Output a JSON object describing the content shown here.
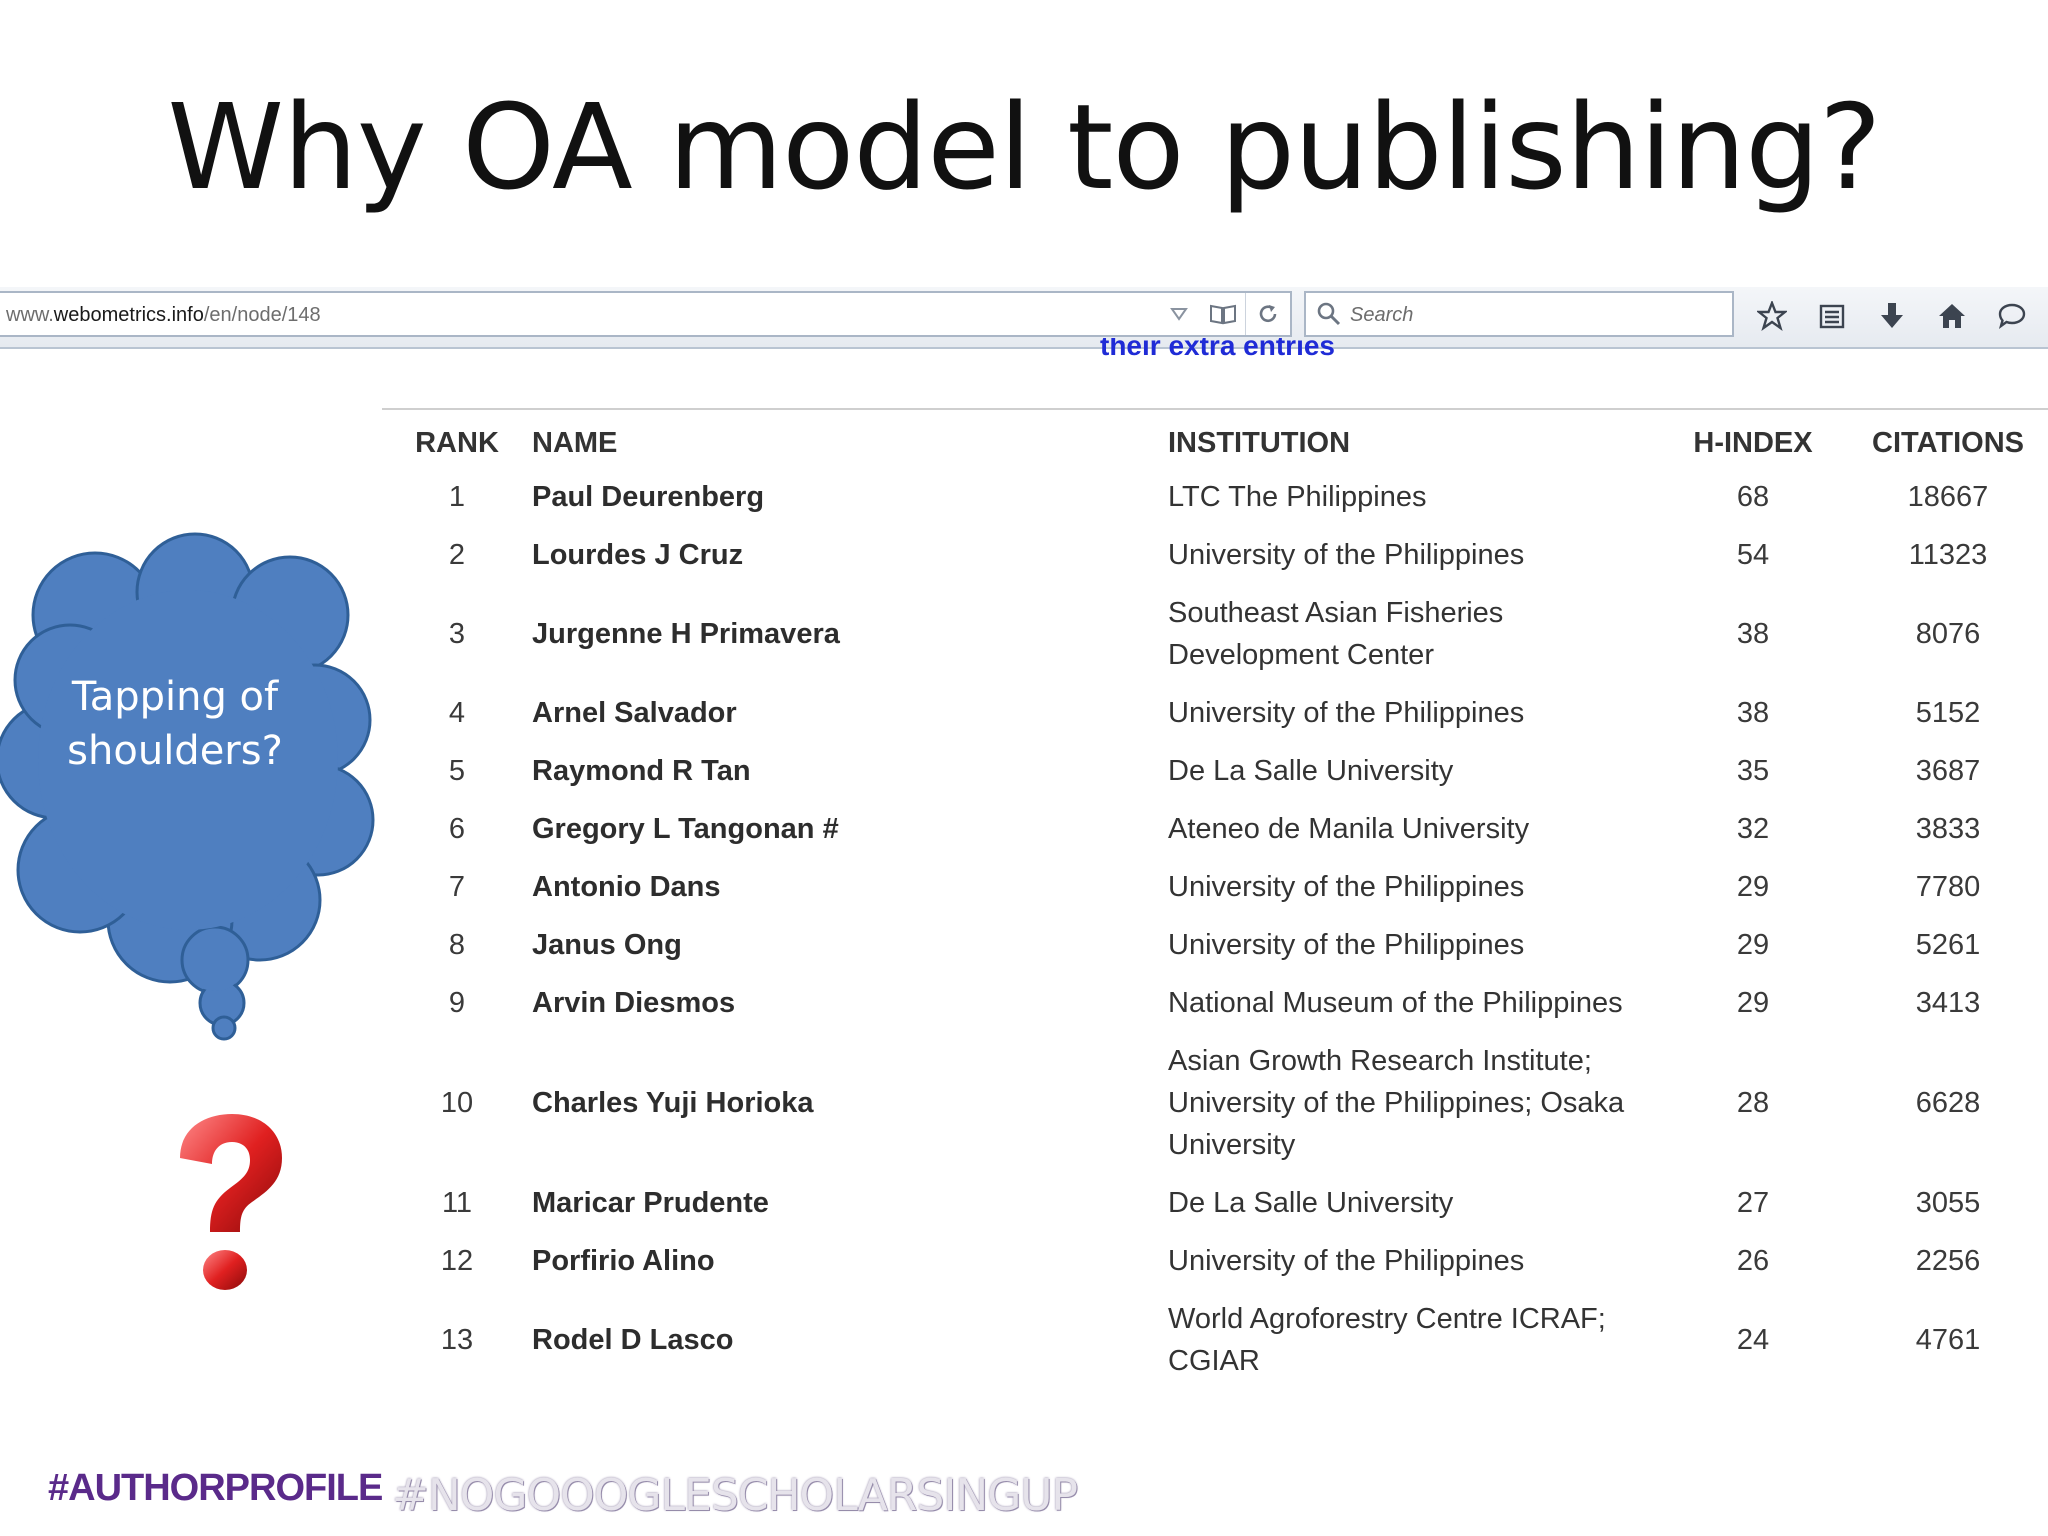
{
  "slide": {
    "title": "Why OA model to publishing?",
    "thought_bubble": "Tapping of shoulders?",
    "hashtag_left": "#AUTHORPROFILE",
    "hashtag_right": "#NOGOOOGLESCHOLARSINGUP"
  },
  "browser": {
    "url_prefix": "www.",
    "url_domain": "webometrics.info",
    "url_path": "/en/node/148",
    "search_placeholder": "Search",
    "partial_text": "their extra entries"
  },
  "table": {
    "headers": {
      "rank": "RANK",
      "name": "NAME",
      "institution": "INSTITUTION",
      "h_index": "H-INDEX",
      "citations": "CITATIONS"
    },
    "rows": [
      {
        "rank": "1",
        "name": "Paul Deurenberg",
        "institution": "LTC The Philippines",
        "h_index": "68",
        "citations": "18667"
      },
      {
        "rank": "2",
        "name": "Lourdes J Cruz",
        "institution": "University of the Philippines",
        "h_index": "54",
        "citations": "11323"
      },
      {
        "rank": "3",
        "name": "Jurgenne H Primavera",
        "institution": "Southeast Asian Fisheries Development Center",
        "h_index": "38",
        "citations": "8076"
      },
      {
        "rank": "4",
        "name": "Arnel Salvador",
        "institution": "University of the Philippines",
        "h_index": "38",
        "citations": "5152"
      },
      {
        "rank": "5",
        "name": "Raymond R Tan",
        "institution": "De La Salle University",
        "h_index": "35",
        "citations": "3687"
      },
      {
        "rank": "6",
        "name": "Gregory L Tangonan #",
        "institution": "Ateneo de Manila University",
        "h_index": "32",
        "citations": "3833"
      },
      {
        "rank": "7",
        "name": "Antonio Dans",
        "institution": "University of the Philippines",
        "h_index": "29",
        "citations": "7780"
      },
      {
        "rank": "8",
        "name": "Janus Ong",
        "institution": "University of the Philippines",
        "h_index": "29",
        "citations": "5261"
      },
      {
        "rank": "9",
        "name": "Arvin Diesmos",
        "institution": "National Museum of the Philippines",
        "h_index": "29",
        "citations": "3413"
      },
      {
        "rank": "10",
        "name": "Charles Yuji Horioka",
        "institution": "Asian Growth Research Institute; University of the Philippines; Osaka University",
        "h_index": "28",
        "citations": "6628"
      },
      {
        "rank": "11",
        "name": "Maricar Prudente",
        "institution": "De La Salle University",
        "h_index": "27",
        "citations": "3055"
      },
      {
        "rank": "12",
        "name": "Porfirio Alino",
        "institution": "University of the Philippines",
        "h_index": "26",
        "citations": "2256"
      },
      {
        "rank": "13",
        "name": "Rodel D Lasco",
        "institution": "World Agroforestry Centre ICRAF; CGIAR",
        "h_index": "24",
        "citations": "4761"
      }
    ]
  }
}
